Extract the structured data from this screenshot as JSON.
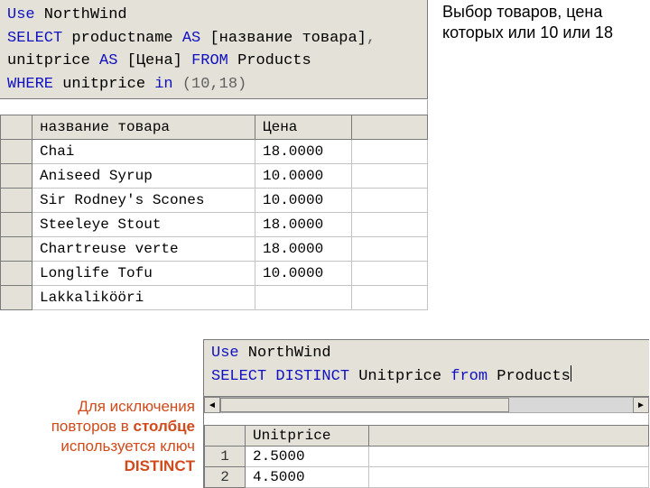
{
  "annotations": {
    "top_right": "Выбор товаров, цена которых или 10 или 18",
    "distinct_l1": "Для исключения",
    "distinct_l2_a": "повторов в ",
    "distinct_l2_b": "столбце",
    "distinct_l3": "используется ключ",
    "distinct_l4": "DISTINCT"
  },
  "sql1": {
    "l1_a": "Use",
    "l1_b": " NorthWind",
    "l2_a": "SELECT",
    "l2_b": " productname ",
    "l2_c": "AS",
    "l2_d": " [название товара]",
    "l2_e": ",",
    "l3_a": "unitprice ",
    "l3_b": "AS",
    "l3_c": " [Цена] ",
    "l3_d": "FROM",
    "l3_e": " Products",
    "l4_a": "WHERE",
    "l4_b": " unitprice ",
    "l4_c": "in",
    "l4_d": " ",
    "l4_e": "(10,18)"
  },
  "grid1": {
    "headers": {
      "c0": "название товара",
      "c1": "Цена"
    },
    "rows": [
      {
        "c0": "Chai",
        "c1": "18.0000"
      },
      {
        "c0": "Aniseed Syrup",
        "c1": "10.0000"
      },
      {
        "c0": "Sir Rodney's Scones",
        "c1": "10.0000"
      },
      {
        "c0": "Steeleye Stout",
        "c1": "18.0000"
      },
      {
        "c0": "Chartreuse verte",
        "c1": "18.0000"
      },
      {
        "c0": "Longlife Tofu",
        "c1": "10.0000"
      },
      {
        "c0": "Lakkalikööri",
        "c1": ""
      }
    ]
  },
  "sql2": {
    "l1_a": "Use",
    "l1_b": " NorthWind",
    "l2_a": "SELECT DISTINCT",
    "l2_b": " Unitprice ",
    "l2_c": "from",
    "l2_d": " Products"
  },
  "grid2": {
    "headers": {
      "c0": "Unitprice"
    },
    "rows": [
      {
        "n": "1",
        "c0": "2.5000"
      },
      {
        "n": "2",
        "c0": "4.5000"
      }
    ]
  },
  "scroll": {
    "left": "◄",
    "right": "►"
  },
  "chart_data": {
    "type": "table",
    "tables": [
      {
        "title": "SELECT productname AS [название товара], unitprice AS [Цена] FROM Products WHERE unitprice in (10,18)",
        "columns": [
          "название товара",
          "Цена"
        ],
        "rows": [
          [
            "Chai",
            18.0
          ],
          [
            "Aniseed Syrup",
            10.0
          ],
          [
            "Sir Rodney's Scones",
            10.0
          ],
          [
            "Steeleye Stout",
            18.0
          ],
          [
            "Chartreuse verte",
            18.0
          ],
          [
            "Longlife Tofu",
            10.0
          ],
          [
            "Lakkalikööri",
            null
          ]
        ]
      },
      {
        "title": "SELECT DISTINCT Unitprice from Products",
        "columns": [
          "Unitprice"
        ],
        "rows": [
          [
            2.5
          ],
          [
            4.5
          ]
        ]
      }
    ]
  }
}
